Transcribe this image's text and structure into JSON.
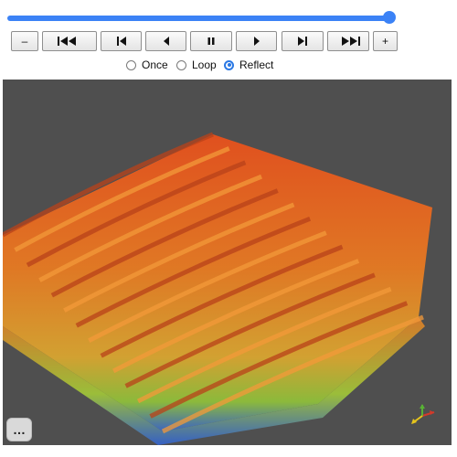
{
  "player": {
    "progress": 1.0,
    "buttons": [
      {
        "name": "slower-button",
        "label": "–",
        "icon": null
      },
      {
        "name": "first-frame-button",
        "label": "",
        "icon": "skip-to-start-icon"
      },
      {
        "name": "step-back-button",
        "label": "",
        "icon": "step-back-icon"
      },
      {
        "name": "play-reverse-button",
        "label": "",
        "icon": "play-reverse-icon"
      },
      {
        "name": "pause-button",
        "label": "",
        "icon": "pause-icon"
      },
      {
        "name": "play-button",
        "label": "",
        "icon": "play-icon"
      },
      {
        "name": "step-forward-button",
        "label": "",
        "icon": "step-forward-icon"
      },
      {
        "name": "last-frame-button",
        "label": "",
        "icon": "skip-to-end-icon"
      },
      {
        "name": "faster-button",
        "label": "+",
        "icon": null
      }
    ],
    "loop_modes": [
      {
        "label": "Once",
        "checked": false
      },
      {
        "label": "Loop",
        "checked": false
      },
      {
        "label": "Reflect",
        "checked": true
      }
    ]
  },
  "viewport": {
    "background": "#4f4f4f",
    "surface_colors": [
      "#e8501c",
      "#e77a22",
      "#d9a530",
      "#8fbf3a",
      "#3a66c9"
    ],
    "more_button_label": "…",
    "axes_colors": {
      "x": "#d33a2a",
      "y": "#58b135",
      "z": "#e6c51c"
    }
  }
}
